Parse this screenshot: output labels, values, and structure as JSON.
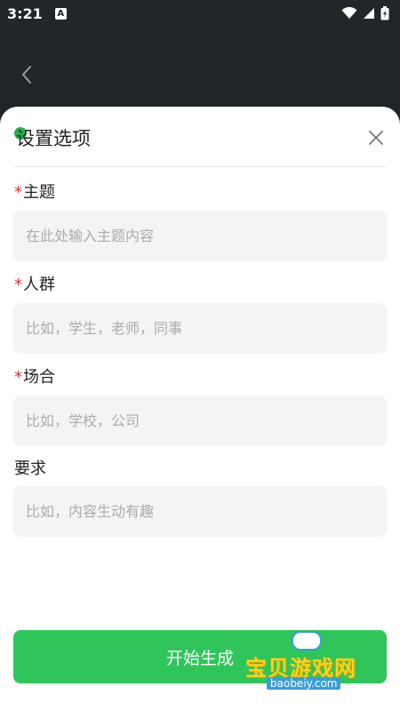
{
  "status_bar": {
    "time": "3:21",
    "notification_badge": "A"
  },
  "sheet": {
    "title": "设置选项",
    "fields": [
      {
        "label": "主题",
        "required": true,
        "placeholder": "在此处输入主题内容",
        "value": ""
      },
      {
        "label": "人群",
        "required": true,
        "placeholder": "比如，学生，老师，同事",
        "value": ""
      },
      {
        "label": "场合",
        "required": true,
        "placeholder": "比如，学校，公司",
        "value": ""
      },
      {
        "label": "要求",
        "required": false,
        "placeholder": "比如，内容生动有趣",
        "value": ""
      }
    ],
    "required_mark": "*",
    "start_button_label": "开始生成"
  },
  "watermark": {
    "text": "宝贝游戏网",
    "url": "baobeiy.com"
  },
  "colors": {
    "accent_green": "#2fc55b",
    "required_red": "#e03030",
    "input_bg": "#f3f4f6"
  }
}
